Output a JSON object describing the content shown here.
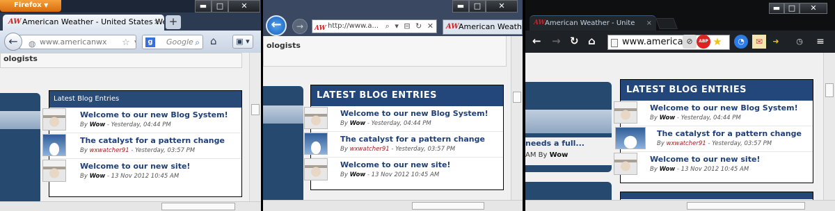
{
  "firefox": {
    "menu_button": "Firefox",
    "tab_title": "American Weather - United States Weat...",
    "tab_close": "×",
    "new_tab": "+",
    "url": "www.americanwx",
    "search_placeholder": "Google",
    "search_engine_letter": "g",
    "page_header": "ologists",
    "blog_header": "Latest Blog Entries",
    "win_min": "▬",
    "win_max": "□",
    "win_close": "✕"
  },
  "ie": {
    "url": "http://www.a...",
    "tab_title": "American Weath",
    "page_header": "ologists",
    "blog_header": "LATEST BLOG ENTRIES",
    "win_min": "▬",
    "win_max": "□",
    "win_close": "✕"
  },
  "chrome": {
    "tab_title": "American Weather - Unite",
    "tab_close": "×",
    "url": "www.americar",
    "blog_header": "LATEST BLOG ENTRIES",
    "partial_title": "needs a full...",
    "partial_meta_prefix": "AM By",
    "partial_author": "Wow",
    "win_min": "▬",
    "win_max": "□",
    "win_close": "✕",
    "ext_abp": "ABP"
  },
  "blog_entries": [
    {
      "title": "Welcome to our new Blog System!",
      "by": "By",
      "author": "Wow",
      "date": " - Yesterday, 04:44 PM",
      "avatar": "cowboy"
    },
    {
      "title": "The catalyst for a pattern change",
      "by": "By",
      "author": "wxwatcher91",
      "date": " - Yesterday, 03:57 PM",
      "avatar": "sky"
    },
    {
      "title": "Welcome to our new site!",
      "by": "By",
      "author": "Wow",
      "date": " - 13 Nov 2012 10:45 AM",
      "avatar": "cowboy"
    }
  ],
  "logo_text": "AW",
  "colors": {
    "blog_header_bg": "#23477a",
    "link": "#1e3f78",
    "author_red": "#a32020",
    "firefox_orange": "#e8821f"
  }
}
